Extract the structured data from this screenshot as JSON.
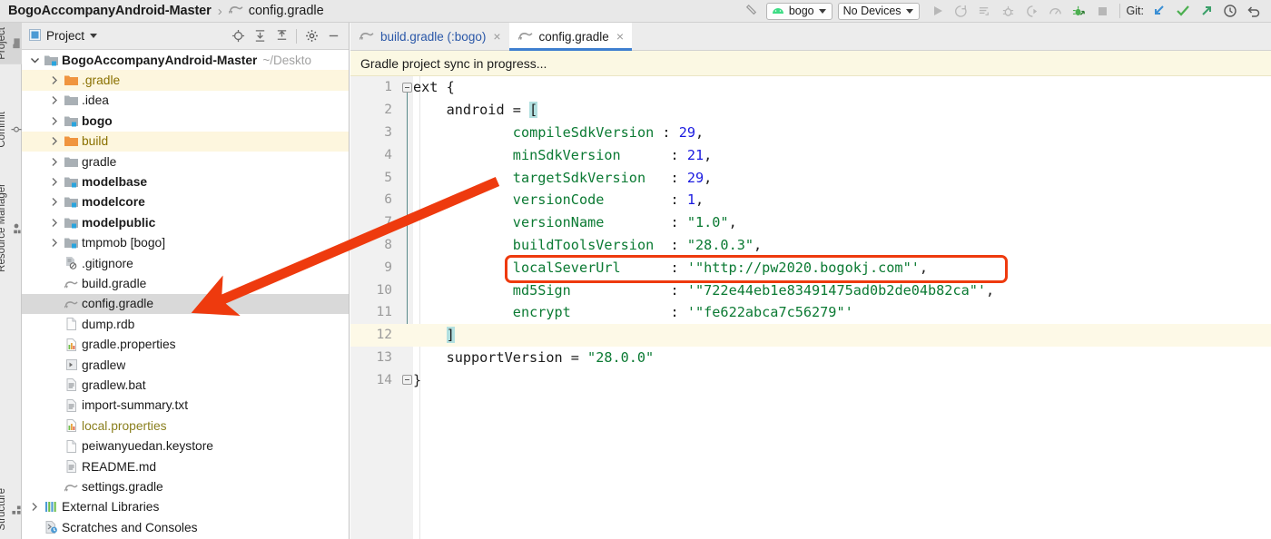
{
  "titlebar": {
    "project_name": "BogoAccompanyAndroid-Master",
    "separator": "›",
    "current_file": "config.gradle",
    "build_icon": "hammer-icon",
    "module_selector": {
      "label": "bogo",
      "icon": "android-icon"
    },
    "device_selector": {
      "label": "No Devices"
    },
    "run_icons": [
      "run-icon",
      "apply-changes-icon",
      "apply-code-changes-icon",
      "debug-icon",
      "run-with-coverage-icon",
      "profiler-icon",
      "attach-debugger-icon",
      "stop-icon"
    ],
    "git_label": "Git:",
    "git_icons": [
      "update-project-icon",
      "commit-icon",
      "push-icon",
      "history-icon",
      "rollback-icon"
    ]
  },
  "toolstrip": {
    "top_tabs": [
      {
        "label": "Project",
        "icon": "project-folder-icon",
        "selected": true
      },
      {
        "label": "Commit",
        "icon": "commit-icon",
        "selected": false
      },
      {
        "label": "Resource Manager",
        "icon": "resource-manager-icon",
        "selected": false
      }
    ],
    "bottom_tabs": [
      {
        "label": "Structure",
        "icon": "structure-icon",
        "selected": false
      }
    ]
  },
  "project_panel": {
    "title": "Project",
    "title_icon": "project-icon",
    "dropdown_icon": "chevron-down-icon",
    "tools": [
      "locate-icon",
      "expand-all-icon",
      "collapse-all-icon",
      "settings-gear-icon",
      "hide-icon"
    ],
    "tree": [
      {
        "label": "BogoAccompanyAndroid-Master",
        "path": "~/Deskto",
        "icon": "module-folder-icon",
        "twisty": "expanded",
        "indent": 0,
        "bold": true,
        "highlight": "none"
      },
      {
        "label": ".gradle",
        "icon": "orange-folder-icon",
        "twisty": "collapsed",
        "indent": 1,
        "bold": false,
        "color": "orange",
        "highlight": "yellow"
      },
      {
        "label": ".idea",
        "icon": "gray-folder-icon",
        "twisty": "collapsed",
        "indent": 1,
        "bold": false,
        "highlight": "none"
      },
      {
        "label": "bogo",
        "icon": "module-folder-icon",
        "twisty": "collapsed",
        "indent": 1,
        "bold": true,
        "highlight": "none"
      },
      {
        "label": "build",
        "icon": "orange-folder-icon",
        "twisty": "collapsed",
        "indent": 1,
        "bold": false,
        "color": "orange",
        "highlight": "yellow"
      },
      {
        "label": "gradle",
        "icon": "gray-folder-icon",
        "twisty": "collapsed",
        "indent": 1,
        "bold": false,
        "highlight": "none"
      },
      {
        "label": "modelbase",
        "icon": "module-folder-icon",
        "twisty": "collapsed",
        "indent": 1,
        "bold": true,
        "highlight": "none"
      },
      {
        "label": "modelcore",
        "icon": "module-folder-icon",
        "twisty": "collapsed",
        "indent": 1,
        "bold": true,
        "highlight": "none"
      },
      {
        "label": "modelpublic",
        "icon": "module-folder-icon",
        "twisty": "collapsed",
        "indent": 1,
        "bold": true,
        "highlight": "none"
      },
      {
        "label": "tmpmob [bogo]",
        "icon": "module-folder-icon",
        "twisty": "collapsed",
        "indent": 1,
        "bold": false,
        "highlight": "none"
      },
      {
        "label": ".gitignore",
        "icon": "gitignore-file-icon",
        "twisty": "none",
        "indent": 1,
        "bold": false,
        "highlight": "none"
      },
      {
        "label": "build.gradle",
        "icon": "gradle-file-icon",
        "twisty": "none",
        "indent": 1,
        "bold": false,
        "highlight": "none"
      },
      {
        "label": "config.gradle",
        "icon": "gradle-file-icon",
        "twisty": "none",
        "indent": 1,
        "bold": false,
        "highlight": "selected"
      },
      {
        "label": "dump.rdb",
        "icon": "plain-file-icon",
        "twisty": "none",
        "indent": 1,
        "bold": false,
        "highlight": "none"
      },
      {
        "label": "gradle.properties",
        "icon": "properties-file-icon",
        "twisty": "none",
        "indent": 1,
        "bold": false,
        "highlight": "none"
      },
      {
        "label": "gradlew",
        "icon": "script-file-icon",
        "twisty": "none",
        "indent": 1,
        "bold": false,
        "highlight": "none"
      },
      {
        "label": "gradlew.bat",
        "icon": "text-file-icon",
        "twisty": "none",
        "indent": 1,
        "bold": false,
        "highlight": "none"
      },
      {
        "label": "import-summary.txt",
        "icon": "text-file-icon",
        "twisty": "none",
        "indent": 1,
        "bold": false,
        "highlight": "none"
      },
      {
        "label": "local.properties",
        "icon": "properties-file-icon",
        "twisty": "none",
        "indent": 1,
        "bold": false,
        "color": "olive",
        "highlight": "none"
      },
      {
        "label": "peiwanyuedan.keystore",
        "icon": "plain-file-icon",
        "twisty": "none",
        "indent": 1,
        "bold": false,
        "highlight": "none"
      },
      {
        "label": "README.md",
        "icon": "text-file-icon",
        "twisty": "none",
        "indent": 1,
        "bold": false,
        "highlight": "none"
      },
      {
        "label": "settings.gradle",
        "icon": "gradle-file-icon",
        "twisty": "none",
        "indent": 1,
        "bold": false,
        "highlight": "none"
      },
      {
        "label": "External Libraries",
        "icon": "libraries-icon",
        "twisty": "collapsed",
        "indent": 0,
        "bold": false,
        "highlight": "none"
      },
      {
        "label": "Scratches and Consoles",
        "icon": "scratches-icon",
        "twisty": "none",
        "indent": 0,
        "bold": false,
        "highlight": "none"
      }
    ]
  },
  "editor": {
    "tabs": [
      {
        "label": "build.gradle (:bogo)",
        "icon": "gradle-file-icon",
        "active": false,
        "close": "×"
      },
      {
        "label": "config.gradle",
        "icon": "gradle-file-icon",
        "active": true,
        "close": "×"
      }
    ],
    "banner": "Gradle project sync in progress...",
    "current_line": 12,
    "lines": [
      {
        "n": "1",
        "indent": 0,
        "text": "ext {"
      },
      {
        "n": "2",
        "indent": 4,
        "text": "android = ["
      },
      {
        "n": "3",
        "indent": 12,
        "key": "compileSdkVersion",
        "colon": ":",
        "value": "29",
        "comma": ",",
        "kind": "number"
      },
      {
        "n": "4",
        "indent": 12,
        "key": "minSdkVersion",
        "colon": " :",
        "value": "21",
        "comma": ",",
        "kind": "number"
      },
      {
        "n": "5",
        "indent": 12,
        "key": "targetSdkVersion",
        "colon": " :",
        "value": "29",
        "comma": ",",
        "kind": "number"
      },
      {
        "n": "6",
        "indent": 12,
        "key": "versionCode",
        "colon": " :",
        "value": "1",
        "comma": ",",
        "kind": "number"
      },
      {
        "n": "7",
        "indent": 12,
        "key": "versionName",
        "colon": " :",
        "value": "\"1.0\"",
        "comma": ",",
        "kind": "string"
      },
      {
        "n": "8",
        "indent": 12,
        "key": "buildToolsVersion",
        "colon": " :",
        "value": "\"28.0.3\"",
        "comma": ",",
        "kind": "string"
      },
      {
        "n": "9",
        "indent": 12,
        "key": "localSeverUrl",
        "colon": " :",
        "value": "'\"http://pw2020.bogokj.com\"'",
        "comma": ",",
        "kind": "string"
      },
      {
        "n": "10",
        "indent": 12,
        "key": "md5Sign",
        "colon": " :",
        "value": "'\"722e44eb1e83491475ad0b2de04b82ca\"'",
        "comma": ",",
        "kind": "string"
      },
      {
        "n": "11",
        "indent": 12,
        "key": "encrypt",
        "colon": " :",
        "value": "'\"fe622abca7c56279\"'",
        "comma": "",
        "kind": "string"
      },
      {
        "n": "12",
        "indent": 4,
        "text": "]"
      },
      {
        "n": "13",
        "indent": 4,
        "text": "supportVersion = ",
        "value": "\"28.0.0\"",
        "kind": "string"
      },
      {
        "n": "14",
        "indent": 0,
        "text": "}"
      }
    ]
  },
  "annotations": {
    "highlight_box_line": 9,
    "highlight_box_color": "#ee3a0e",
    "arrow_color": "#ee3a0e",
    "arrow_points_to": "config.gradle"
  },
  "colors": {
    "accent_blue": "#3e7fd0",
    "keyword_green": "#0b7a33",
    "number_blue": "#1a1ae0",
    "annotation_red": "#ee3a0e",
    "banner_yellow": "#fbf8e3"
  }
}
